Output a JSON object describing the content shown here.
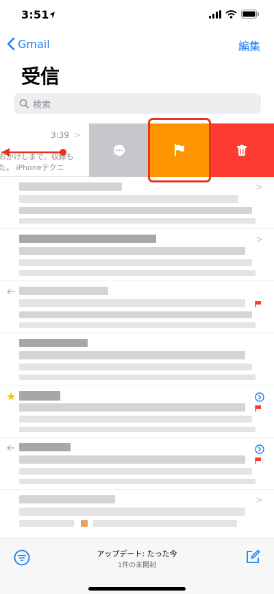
{
  "status_bar": {
    "time": "3:51"
  },
  "nav": {
    "back_label": "Gmail",
    "edit_label": "編集",
    "title": "受信"
  },
  "search": {
    "placeholder": "検索"
  },
  "first_row": {
    "time": "3:39",
    "chevron": ">",
    "line1": "おかけしまで、収録も",
    "line2": "た。 iPhoneテクニ"
  },
  "swipe_actions": [
    {
      "name": "more",
      "icon": "ellipsis-icon",
      "color": "#c7c7cc"
    },
    {
      "name": "flag",
      "icon": "flag-icon",
      "color": "#fd9500"
    },
    {
      "name": "trash",
      "icon": "trash-icon",
      "color": "#fd3b30"
    }
  ],
  "list_chevron": ">",
  "bottom_bar": {
    "update_text": "アップデート: たった今",
    "unread_text": "1件の未開封"
  },
  "colors": {
    "accent": "#1a7cf5",
    "highlight": "#e8321c",
    "flag": "#fd3b30",
    "star": "#f5c400"
  }
}
